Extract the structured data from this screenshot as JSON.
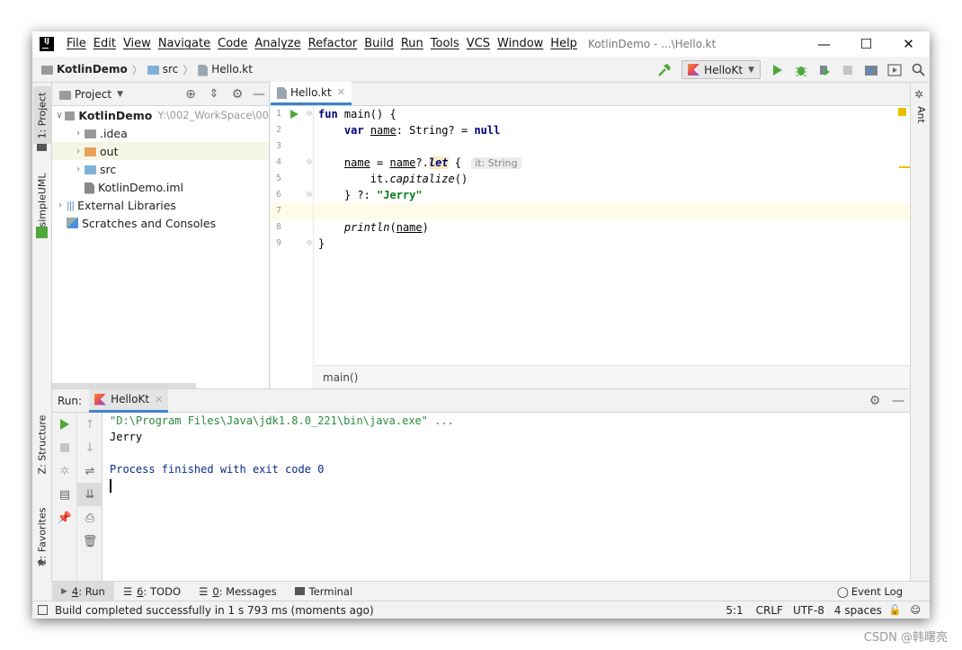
{
  "window": {
    "title": "KotlinDemo - ...\\Hello.kt",
    "app_logo": "IJ",
    "controls": [
      "—",
      "☐",
      "✕"
    ]
  },
  "menu": [
    "File",
    "Edit",
    "View",
    "Navigate",
    "Code",
    "Analyze",
    "Refactor",
    "Build",
    "Run",
    "Tools",
    "VCS",
    "Window",
    "Help"
  ],
  "navbar": {
    "project": "KotlinDemo",
    "folder": "src",
    "file": "Hello.kt",
    "run_config": "HelloKt"
  },
  "left_strip": {
    "project": "1: Project",
    "uml": "simpleUML",
    "structure": "Z: Structure",
    "favorites": "2: Favorites"
  },
  "right_strip": {
    "ant": "Ant"
  },
  "project_panel": {
    "title": "Project",
    "tree": [
      {
        "label": "KotlinDemo",
        "extra": "Y:\\002_WorkSpace\\00",
        "icon": "module-folder",
        "level": 0,
        "arrow": "v",
        "bold": true
      },
      {
        "label": ".idea",
        "icon": "folder-gray",
        "level": 1,
        "arrow": ">"
      },
      {
        "label": "out",
        "icon": "folder-orange",
        "level": 1,
        "arrow": ">",
        "selected": true
      },
      {
        "label": "src",
        "icon": "folder-blue",
        "level": 1,
        "arrow": ">"
      },
      {
        "label": "KotlinDemo.iml",
        "icon": "iml-file",
        "level": 1,
        "arrow": ""
      },
      {
        "label": "External Libraries",
        "icon": "libraries",
        "level": 0,
        "arrow": ">"
      },
      {
        "label": "Scratches and Consoles",
        "icon": "scratches",
        "level": 0,
        "arrow": ""
      }
    ]
  },
  "editor": {
    "tab": "Hello.kt",
    "breadcrumb": "main()",
    "line_numbers": [
      "1",
      "2",
      "3",
      "4",
      "5",
      "6",
      "7",
      "8",
      "9"
    ],
    "hint": "it: String"
  },
  "run_panel": {
    "label": "Run:",
    "tab": "HelloKt",
    "console": [
      "\"D:\\Program Files\\Java\\jdk1.8.0_221\\bin\\java.exe\" ...",
      "Jerry",
      "",
      "Process finished with exit code 0"
    ]
  },
  "bottom_tabs": [
    {
      "key": "4",
      "label": ": Run"
    },
    {
      "key": "6",
      "label": ": TODO"
    },
    {
      "key": "0",
      "label": ": Messages"
    },
    {
      "key": "",
      "label": "Terminal"
    }
  ],
  "event_log": "Event Log",
  "status": {
    "message": "Build completed successfully in 1 s 793 ms (moments ago)",
    "position": "5:1",
    "line_sep": "CRLF",
    "encoding": "UTF-8",
    "indent": "4 spaces"
  },
  "watermark": "CSDN @韩曙亮",
  "colors": {
    "keyword": "#000080",
    "string": "#067d17",
    "console_blue": "#0a2a8c",
    "console_cmd": "#2a8a3e",
    "run_green": "#4ea83c",
    "selected_tab": "#4083c9"
  }
}
